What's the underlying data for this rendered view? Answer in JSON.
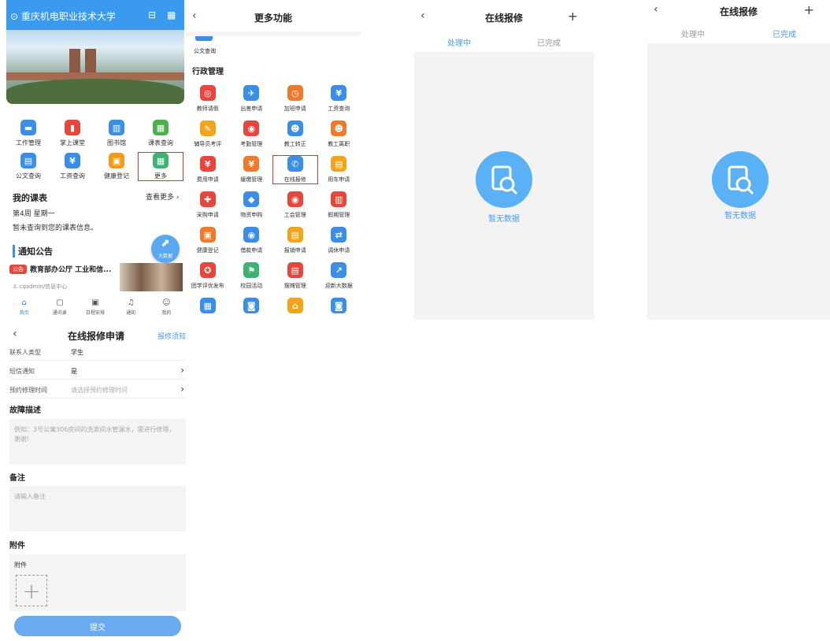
{
  "home": {
    "school_name": "重庆机电职业技术大学",
    "apps_row1": [
      {
        "label": "工作管理",
        "icon": "briefcase-icon",
        "color": "#3a8ee6",
        "glyph": "▬"
      },
      {
        "label": "掌上课堂",
        "icon": "book-icon",
        "color": "#e8453c",
        "glyph": "▮"
      },
      {
        "label": "图书馆",
        "icon": "library-icon",
        "color": "#3a8ee6",
        "glyph": "▥"
      },
      {
        "label": "课表查询",
        "icon": "calendar-icon",
        "color": "#4caf50",
        "glyph": "▦"
      }
    ],
    "apps_row2": [
      {
        "label": "公文查询",
        "icon": "document-icon",
        "color": "#3a8ee6",
        "glyph": "▤"
      },
      {
        "label": "工资查询",
        "icon": "money-bag-icon",
        "color": "#3a8ee6",
        "glyph": "¥"
      },
      {
        "label": "健康登记",
        "icon": "health-icon",
        "color": "#f29a1c",
        "glyph": "▣"
      },
      {
        "label": "更多",
        "icon": "grid-icon",
        "color": "#3cb371",
        "glyph": "▦"
      }
    ],
    "schedule_title": "我的课表",
    "schedule_more": "查看更多",
    "week_text": "第4周  星期一",
    "schedule_empty": "暂未查询到您的课表信息。",
    "notice_title": "通知公告",
    "notice_badge": "公告",
    "notice_headline": "教育部办公厅 工业和信...",
    "notice_author": "cqadmin/信息中心",
    "fab_label": "大数据",
    "tabbar": [
      {
        "label": "首页",
        "icon": "home-icon",
        "glyph": "⌂",
        "active": true
      },
      {
        "label": "通讯录",
        "icon": "contacts-icon",
        "glyph": "▢",
        "active": false
      },
      {
        "label": "日程安排",
        "icon": "schedule-icon",
        "glyph": "▣",
        "active": false
      },
      {
        "label": "通知",
        "icon": "bell-icon",
        "glyph": "♫",
        "active": false
      },
      {
        "label": "我的",
        "icon": "profile-icon",
        "glyph": "☺",
        "active": false
      }
    ]
  },
  "more": {
    "title": "更多功能",
    "top_item": "公文查询",
    "section": "行政管理",
    "rows": [
      [
        {
          "label": "教师请假",
          "icon": "leave-icon",
          "color": "#e8453c",
          "glyph": "◎"
        },
        {
          "label": "出差申请",
          "icon": "plane-icon",
          "color": "#3a8ee6",
          "glyph": "✈"
        },
        {
          "label": "加班申请",
          "icon": "overtime-icon",
          "color": "#f07a2c",
          "glyph": "◷"
        },
        {
          "label": "工资查询",
          "icon": "money-bag-icon",
          "color": "#3a8ee6",
          "glyph": "¥"
        }
      ],
      [
        {
          "label": "辅导员考评",
          "icon": "evaluation-icon",
          "color": "#f2a51c",
          "glyph": "✎"
        },
        {
          "label": "考勤管理",
          "icon": "attendance-icon",
          "color": "#e8453c",
          "glyph": "◉"
        },
        {
          "label": "教工转正",
          "icon": "staff-confirm-icon",
          "color": "#3a8ee6",
          "glyph": "☻"
        },
        {
          "label": "教工离职",
          "icon": "staff-leave-icon",
          "color": "#f07a2c",
          "glyph": "☻"
        }
      ],
      [
        {
          "label": "费用申请",
          "icon": "expense-icon",
          "color": "#e8453c",
          "glyph": "¥"
        },
        {
          "label": "缓缴管理",
          "icon": "deferral-icon",
          "color": "#f07a2c",
          "glyph": "¥"
        },
        {
          "label": "在线报修",
          "icon": "wrench-icon",
          "color": "#3a8ee6",
          "glyph": "✆"
        },
        {
          "label": "用车申请",
          "icon": "car-icon",
          "color": "#f2a51c",
          "glyph": "▤"
        }
      ],
      [
        {
          "label": "采购申请",
          "icon": "purchase-icon",
          "color": "#e8453c",
          "glyph": "✚"
        },
        {
          "label": "物资申购",
          "icon": "box-icon",
          "color": "#3a8ee6",
          "glyph": "◆"
        },
        {
          "label": "工会管理",
          "icon": "union-icon",
          "color": "#e8453c",
          "glyph": "◉"
        },
        {
          "label": "假期管理",
          "icon": "holiday-icon",
          "color": "#e8453c",
          "glyph": "▥"
        }
      ],
      [
        {
          "label": "健康登记",
          "icon": "health-icon",
          "color": "#f07a2c",
          "glyph": "▣"
        },
        {
          "label": "借款申请",
          "icon": "loan-icon",
          "color": "#3a8ee6",
          "glyph": "◉"
        },
        {
          "label": "报销申请",
          "icon": "reimburse-icon",
          "color": "#f2a51c",
          "glyph": "▤"
        },
        {
          "label": "调休申请",
          "icon": "swap-icon",
          "color": "#3a8ee6",
          "glyph": "⇄"
        }
      ],
      [
        {
          "label": "团学评优发布",
          "icon": "award-icon",
          "color": "#e8453c",
          "glyph": "✪"
        },
        {
          "label": "校园活动",
          "icon": "flag-icon",
          "color": "#3cb371",
          "glyph": "⚑"
        },
        {
          "label": "摆摊管理",
          "icon": "stall-icon",
          "color": "#e8453c",
          "glyph": "▤"
        },
        {
          "label": "迎新大数据",
          "icon": "chart-icon",
          "color": "#3a8ee6",
          "glyph": "↗"
        }
      ],
      [
        {
          "label": "",
          "icon": "building-icon",
          "color": "#3a8ee6",
          "glyph": "▦"
        },
        {
          "label": "",
          "icon": "search-doc-icon",
          "color": "#3a8ee6",
          "glyph": "◙"
        },
        {
          "label": "",
          "icon": "house-icon",
          "color": "#f2a51c",
          "glyph": "⌂"
        },
        {
          "label": "",
          "icon": "search-doc-icon",
          "color": "#3a8ee6",
          "glyph": "◙"
        }
      ]
    ]
  },
  "repair_list": {
    "title": "在线报修",
    "tab_processing": "处理中",
    "tab_done": "已完成",
    "empty_text": "暂无数据"
  },
  "repair_form": {
    "title": "在线报修申请",
    "notice_link": "报修须知",
    "rows": [
      {
        "label": "联系人类型",
        "value": "学生",
        "placeholder": false,
        "chevron": false
      },
      {
        "label": "短信通知",
        "value": "是",
        "placeholder": false,
        "chevron": true
      },
      {
        "label": "预约修理时间",
        "value": "请选择预约修理时间",
        "placeholder": true,
        "chevron": true
      }
    ],
    "fault_title": "故障描述",
    "fault_placeholder": "例如：3号公寓306房间的洗漱间水管漏水，需进行修理，谢谢!",
    "remark_title": "备注",
    "remark_placeholder": "请输入备注",
    "attachment_title": "附件",
    "attachment_label": "附件",
    "submit": "提交"
  }
}
